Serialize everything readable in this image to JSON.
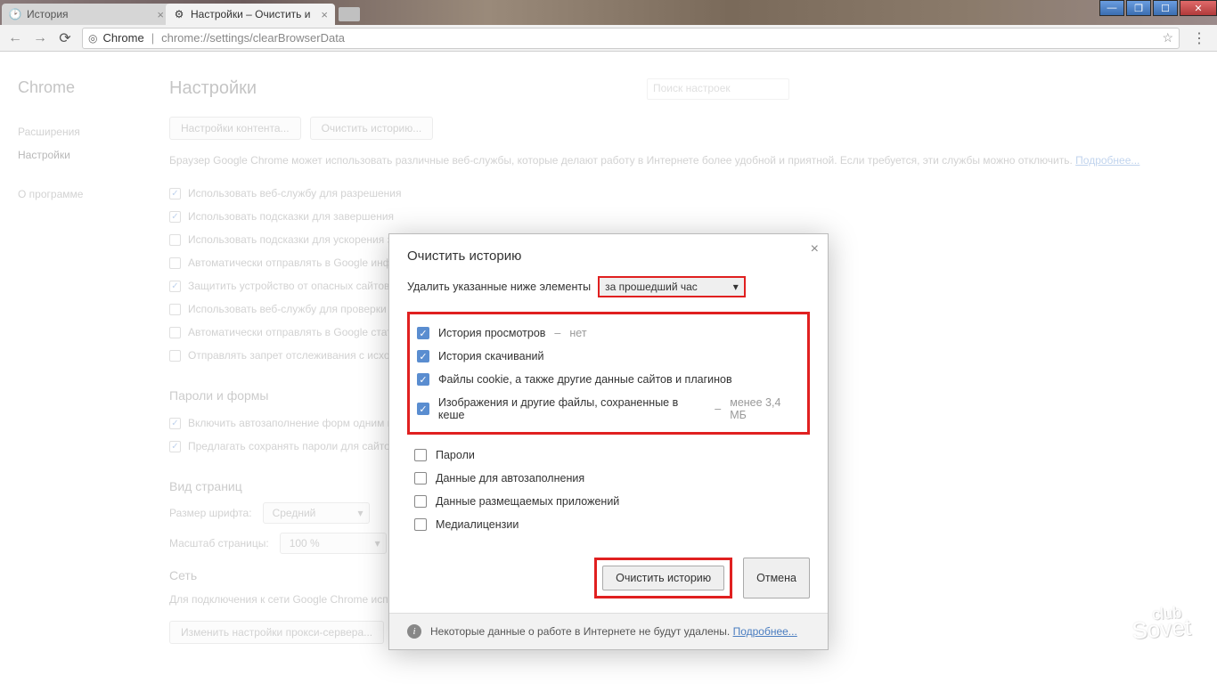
{
  "window": {
    "tabs": [
      {
        "title": "История"
      },
      {
        "title": "Настройки – Очистить и"
      }
    ]
  },
  "toolbar": {
    "scheme_label": "Chrome",
    "url": "chrome://settings/clearBrowserData"
  },
  "sidebar": {
    "brand": "Chrome",
    "items": [
      {
        "label": "Расширения"
      },
      {
        "label": "Настройки"
      },
      {
        "label": "О программе"
      }
    ]
  },
  "settings": {
    "title": "Настройки",
    "search_placeholder": "Поиск настроек",
    "btn_content": "Настройки контента...",
    "btn_clear": "Очистить историю...",
    "description": "Браузер Google Chrome может использовать различные веб-службы, которые делают работу в Интернете более удобной и приятной. Если требуется, эти службы можно отключить.",
    "learn_more": "Подробнее...",
    "privacy_checks": [
      {
        "checked": true,
        "label": "Использовать веб-службу для разрешения"
      },
      {
        "checked": true,
        "label": "Использовать подсказки для завершения"
      },
      {
        "checked": false,
        "label": "Использовать подсказки для ускорения за"
      },
      {
        "checked": false,
        "label": "Автоматически отправлять в Google инфор"
      },
      {
        "checked": true,
        "label": "Защитить устройство от опасных сайтов"
      },
      {
        "checked": false,
        "label": "Использовать веб-службу для проверки пр"
      },
      {
        "checked": false,
        "label": "Автоматически отправлять в Google стати"
      },
      {
        "checked": false,
        "label": "Отправлять запрет отслеживания с исходя"
      }
    ],
    "section_passwords": "Пароли и формы",
    "passwords_checks": [
      {
        "checked": true,
        "label": "Включить автозаполнение форм одним кл"
      },
      {
        "checked": true,
        "label": "Предлагать сохранять пароли для сайтов Н"
      }
    ],
    "section_view": "Вид страниц",
    "font_size_label": "Размер шрифта:",
    "font_size_value": "Средний",
    "zoom_label": "Масштаб страницы:",
    "zoom_value": "100 %",
    "section_network": "Сеть",
    "net_desc": "Для подключения к сети Google Chrome использует системные настройки прокси-сервера.",
    "net_btn": "Изменить настройки прокси-сервера..."
  },
  "modal": {
    "title": "Очистить историю",
    "range_label": "Удалить указанные ниже элементы",
    "range_value": "за прошедший час",
    "items_highlighted": [
      {
        "checked": true,
        "label": "История просмотров",
        "sub": "нет"
      },
      {
        "checked": true,
        "label": "История скачиваний",
        "sub": ""
      },
      {
        "checked": true,
        "label": "Файлы cookie, а также другие данные сайтов и плагинов",
        "sub": ""
      },
      {
        "checked": true,
        "label": "Изображения и другие файлы, сохраненные в кеше",
        "sub": "менее 3,4 МБ"
      }
    ],
    "items_plain": [
      {
        "checked": false,
        "label": "Пароли"
      },
      {
        "checked": false,
        "label": "Данные для автозаполнения"
      },
      {
        "checked": false,
        "label": "Данные размещаемых приложений"
      },
      {
        "checked": false,
        "label": "Медиалицензии"
      }
    ],
    "primary_btn": "Очистить историю",
    "cancel_btn": "Отмена",
    "footer_text": "Некоторые данные о работе в Интернете не будут удалены.",
    "footer_link": "Подробнее..."
  },
  "watermark": {
    "top": "club",
    "bottom": "Sovet"
  }
}
